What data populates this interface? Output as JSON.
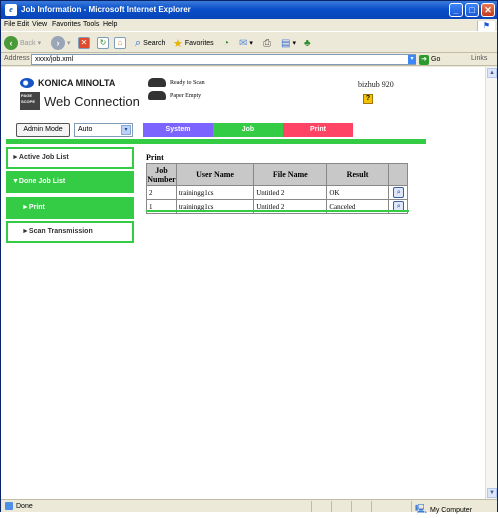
{
  "window": {
    "title": "Job Information - Microsoft Internet Explorer"
  },
  "menubar": {
    "items": [
      "File",
      "Edit",
      "View",
      "Favorites",
      "Tools",
      "Help"
    ]
  },
  "toolbar": {
    "back": "Back",
    "search": "Search",
    "favorites": "Favorites"
  },
  "address": {
    "label": "Address",
    "value": "xxxx/job.xml",
    "go": "Go",
    "links": "Links"
  },
  "status": {
    "text": "Done",
    "zone": "My Computer"
  },
  "header": {
    "brand": "KONICA MINOLTA",
    "logo_tag": "PAGE SCOPE",
    "product": "Web Connection",
    "device_status": [
      "Ready to Scan",
      "Paper Empty"
    ],
    "model": "bizhub 920",
    "help": "?"
  },
  "controls": {
    "admin_mode": "Admin Mode",
    "auto_select": "Auto"
  },
  "tabs": [
    "System",
    "Job",
    "Print"
  ],
  "sidebar": {
    "items": [
      "►Active Job List",
      "▼Done Job List",
      "►Print",
      "►Scan Transmission"
    ]
  },
  "main": {
    "title": "Print",
    "columns": [
      "Job Number",
      "User Name",
      "File Name",
      "Result",
      ""
    ],
    "rows": [
      {
        "job": "2",
        "user": "trainingg1cs",
        "file": "Untitled 2",
        "result": "OK"
      },
      {
        "job": "1",
        "user": "trainingg1cs",
        "file": "Untitled 2",
        "result": "Canceled"
      }
    ]
  }
}
